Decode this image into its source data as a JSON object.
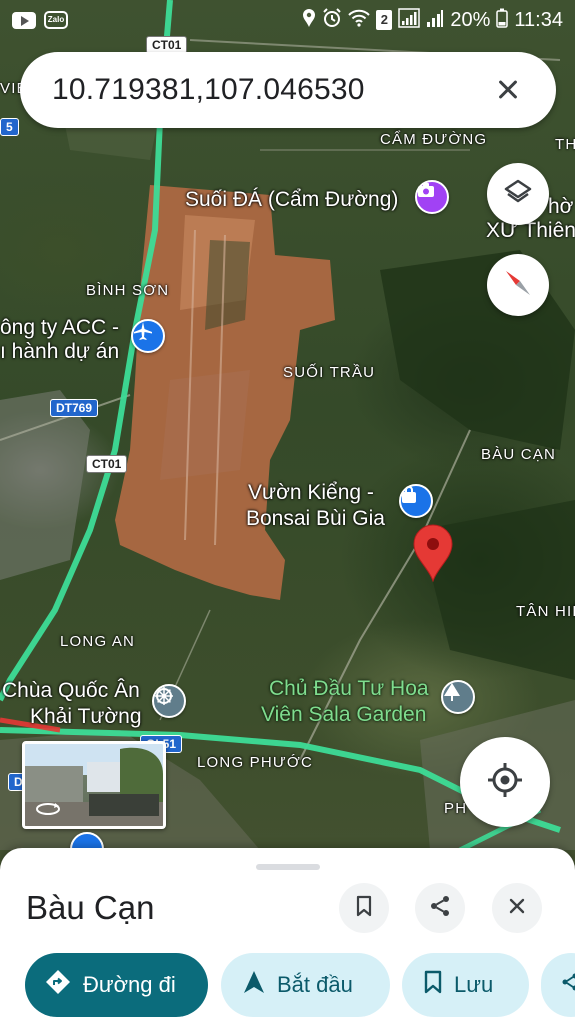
{
  "status_bar": {
    "left_icons": [
      "youtube-icon",
      "zalo-icon"
    ],
    "zalo_label": "Zalo",
    "sim_badge": "2",
    "battery": "20%",
    "time": "11:34"
  },
  "search": {
    "query": "10.719381,107.046530"
  },
  "map": {
    "area_labels": {
      "cam_duong": "CẨM ĐƯỜNG",
      "binh_son": "BÌNH SƠN",
      "suoi_trau": "SUỐI TRẦU",
      "bau_can": "BÀU CẠN",
      "tan_hiep": "TÂN HIỆ",
      "long_an": "LONG AN",
      "long_phuoc": "LONG PHƯỚC",
      "th_edge": "TH",
      "vie_edge": "VIE",
      "ph_edge": "PH"
    },
    "poi_labels": {
      "suoi_da": "Suối ĐÁ (Cẩm Đường)",
      "cong_ty_line1": "ông ty ACC -",
      "cong_ty_line2": "ı hành dự án",
      "vuon_kieng_line1": "Vườn Kiểng -",
      "vuon_kieng_line2": "Bonsai Bùi Gia",
      "chua_line1": "Chùa Quốc Ân",
      "chua_line2": "Khải Tường",
      "chu_dau_tu_line1": "Chủ Đầu Tư Hoa",
      "chu_dau_tu_line2": "Viên Sala Garden",
      "xu_thien_line1": "hờ",
      "xu_thien_line2": "XỨ Thiên"
    },
    "road_shields": {
      "ct01_top": "CT01",
      "ct01_mid": "CT01",
      "dt769": "DT769",
      "ql51": "QL51",
      "five": "5",
      "d": "D"
    },
    "colors": {
      "highway": "#3ddc97",
      "pin_red": "#e53935",
      "poi_blue": "#1a73e8",
      "poi_purple": "#a142f4",
      "poi_gray": "#607d8b"
    }
  },
  "sheet": {
    "title": "Bàu Cạn",
    "actions": {
      "directions": "Đường đi",
      "start": "Bắt đầu",
      "save": "Lưu"
    }
  }
}
